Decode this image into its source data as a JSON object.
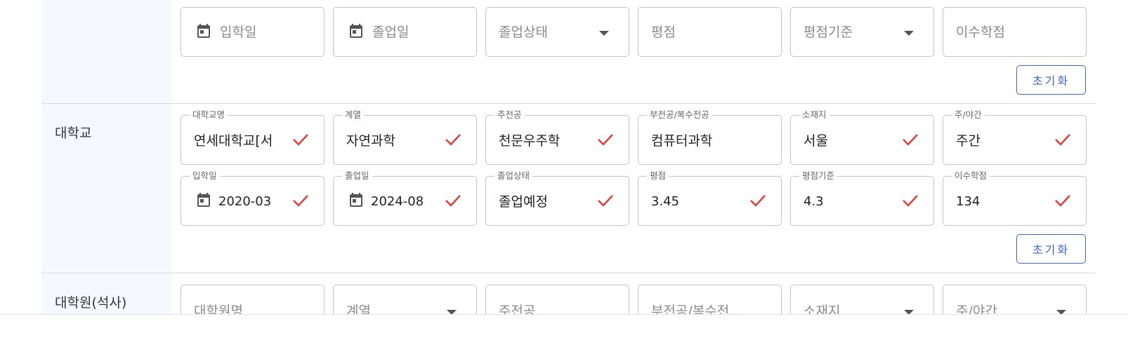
{
  "top_row": {
    "fields": [
      {
        "placeholder": "입학일",
        "icon": "calendar-icon",
        "kind": "date"
      },
      {
        "placeholder": "졸업일",
        "icon": "calendar-icon",
        "kind": "date"
      },
      {
        "placeholder": "졸업상태",
        "kind": "select"
      },
      {
        "placeholder": "평점",
        "kind": "text"
      },
      {
        "placeholder": "평점기준",
        "kind": "select"
      },
      {
        "placeholder": "이수학점",
        "kind": "text"
      }
    ],
    "reset_label": "초기화"
  },
  "university": {
    "section_label": "대학교",
    "row1": [
      {
        "label": "대학교명",
        "value": "연세대학교[서",
        "valid": true
      },
      {
        "label": "계열",
        "value": "자연과학",
        "valid": true
      },
      {
        "label": "주전공",
        "value": "천문우주학",
        "valid": true
      },
      {
        "label": "부전공/복수전공",
        "value": "컴퓨터과학",
        "valid": false
      },
      {
        "label": "소재지",
        "value": "서울",
        "valid": true
      },
      {
        "label": "주/야간",
        "value": "주간",
        "valid": true
      }
    ],
    "row2": [
      {
        "label": "입학일",
        "value": "2020-03",
        "valid": true,
        "icon": "calendar-icon"
      },
      {
        "label": "졸업일",
        "value": "2024-08",
        "valid": true,
        "icon": "calendar-icon"
      },
      {
        "label": "졸업상태",
        "value": "졸업예정",
        "valid": true
      },
      {
        "label": "평점",
        "value": "3.45",
        "valid": true
      },
      {
        "label": "평점기준",
        "value": "4.3",
        "valid": true
      },
      {
        "label": "이수학점",
        "value": "134",
        "valid": true
      }
    ],
    "reset_label": "초기화"
  },
  "graduate": {
    "section_label": "대학원(석사)",
    "fields": [
      {
        "placeholder": "대학원명",
        "kind": "text"
      },
      {
        "placeholder": "계열",
        "kind": "select"
      },
      {
        "placeholder": "주전공",
        "kind": "text"
      },
      {
        "placeholder": "부전공/복수전...",
        "kind": "text"
      },
      {
        "placeholder": "소재지",
        "kind": "select"
      },
      {
        "placeholder": "주/야간",
        "kind": "select"
      }
    ]
  },
  "colors": {
    "accent": "#3d63d6",
    "check": "#e53935",
    "label_bg": "#f5f8fe",
    "border": "#c4c4c4"
  }
}
